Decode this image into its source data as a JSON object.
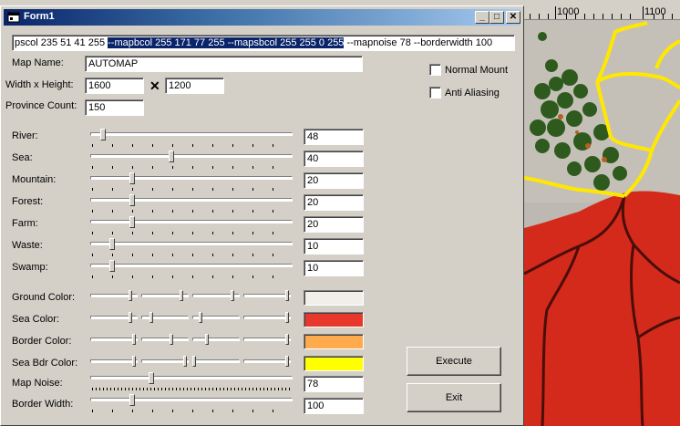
{
  "window": {
    "title": "Form1"
  },
  "command_line": {
    "pre": "pscol  235  51  41  255 ",
    "selected": "--mapbcol  255  171  77  255 --mapsbcol  255  255  0  255",
    "post": " --mapnoise  78 --borderwidth  100"
  },
  "map_name": {
    "label": "Map Name:",
    "value": "AUTOMAP"
  },
  "size": {
    "label": "Width x Height:",
    "width": "1600",
    "separator": "✕",
    "height": "1200"
  },
  "province": {
    "label": "Province Count:",
    "value": "150"
  },
  "options": {
    "normal_mount": "Normal Mount",
    "anti_aliasing": "Anti Aliasing"
  },
  "sliders": [
    {
      "label": "River:",
      "value": "48",
      "level": 0.05
    },
    {
      "label": "Sea:",
      "value": "40",
      "level": 0.4
    },
    {
      "label": "Mountain:",
      "value": "20",
      "level": 0.2
    },
    {
      "label": "Forest:",
      "value": "20",
      "level": 0.2
    },
    {
      "label": "Farm:",
      "value": "20",
      "level": 0.2
    },
    {
      "label": "Waste:",
      "value": "10",
      "level": 0.1
    },
    {
      "label": "Swamp:",
      "value": "10",
      "level": 0.1
    }
  ],
  "colors": [
    {
      "label": "Ground Color:",
      "swatch": "#f2efe8",
      "levels": [
        0.92,
        0.92,
        0.92,
        1.0
      ]
    },
    {
      "label": "Sea Color:",
      "swatch": "#e8382c",
      "levels": [
        0.92,
        0.2,
        0.16,
        1.0
      ]
    },
    {
      "label": "Border Color:",
      "swatch": "#ffab4d",
      "levels": [
        1.0,
        0.67,
        0.3,
        1.0
      ]
    },
    {
      "label": "Sea Bdr Color:",
      "swatch": "#ffff00",
      "levels": [
        1.0,
        1.0,
        0.0,
        1.0
      ]
    }
  ],
  "noise": {
    "label": "Map Noise:",
    "value": "78",
    "level": 0.3
  },
  "border": {
    "label": "Border Width:",
    "value": "100",
    "level": 0.2
  },
  "buttons": {
    "execute": "Execute",
    "exit": "Exit"
  },
  "ruler": {
    "a": "1000",
    "b": "1100"
  }
}
